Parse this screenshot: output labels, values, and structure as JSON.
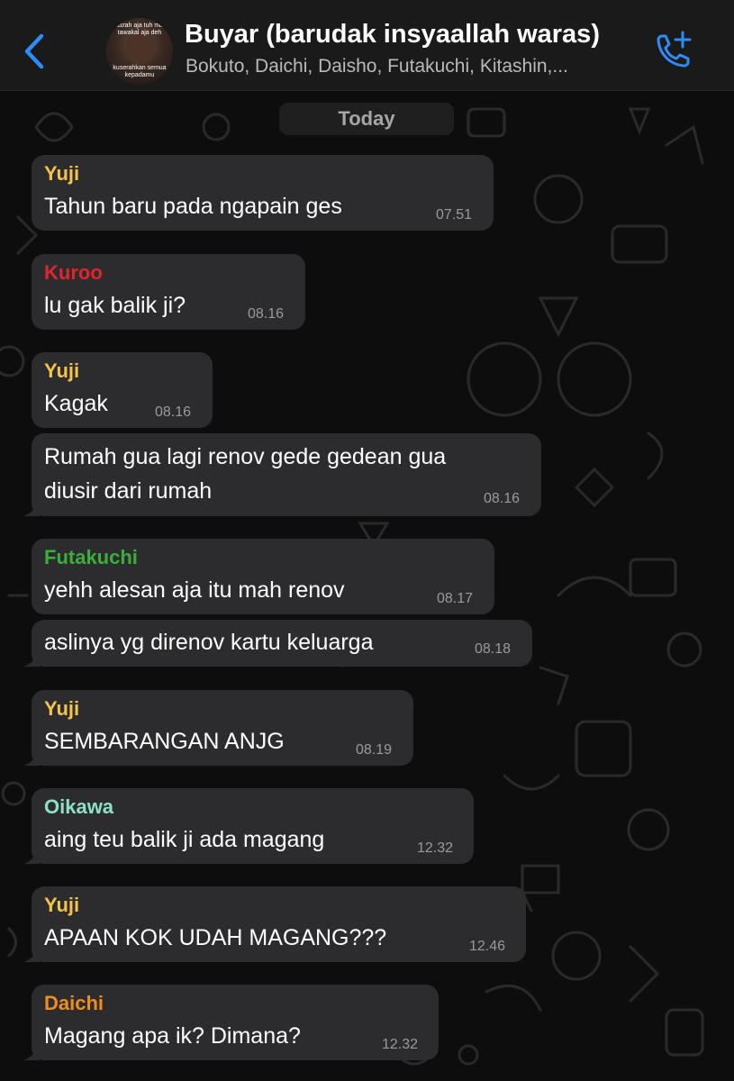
{
  "header": {
    "back_icon": "chevron-left-icon",
    "avatar_caption_top": "pasrah aja tuh mae tawakal aja deh",
    "avatar_caption_bottom": "kuserahkan semua kepadamu",
    "title": "Buyar (barudak insyaallah waras)",
    "subtitle": "Bokuto, Daichi, Daisho, Futakuchi, Kitashin,...",
    "call_icon": "add-call-icon"
  },
  "date_divider": "Today",
  "colors": {
    "accent_blue": "#2f8bf7",
    "bubble": "#2c2c2e",
    "yuji": "#f3c34a",
    "kuroo": "#e0262c",
    "futakuchi": "#3cae3c",
    "oikawa": "#8ee0c4",
    "daichi": "#ee8e22"
  },
  "messages": [
    {
      "sender": "Yuji",
      "text": "Tahun baru pada ngapain ges",
      "time": "07.51"
    },
    {
      "sender": "Kuroo",
      "text": "lu gak balik ji?",
      "time": "08.16"
    },
    {
      "sender": "Yuji",
      "text": "Kagak",
      "time": "08.16"
    },
    {
      "sender": "",
      "text_line1": "Rumah gua lagi renov gede gedean gua",
      "text_line2": "diusir dari rumah",
      "time": "08.16"
    },
    {
      "sender": "Futakuchi",
      "text": "yehh alesan aja itu mah renov",
      "time": "08.17"
    },
    {
      "sender": "",
      "text": "aslinya yg direnov kartu keluarga",
      "time": "08.18"
    },
    {
      "sender": "Yuji",
      "text": "SEMBARANGAN ANJG",
      "time": "08.19"
    },
    {
      "sender": "Oikawa",
      "text": "aing teu balik ji ada magang",
      "time": "12.32"
    },
    {
      "sender": "Yuji",
      "text": "APAAN KOK UDAH MAGANG???",
      "time": "12.46"
    },
    {
      "sender": "Daichi",
      "text": "Magang apa ik? Dimana?",
      "time": "12.32"
    }
  ]
}
